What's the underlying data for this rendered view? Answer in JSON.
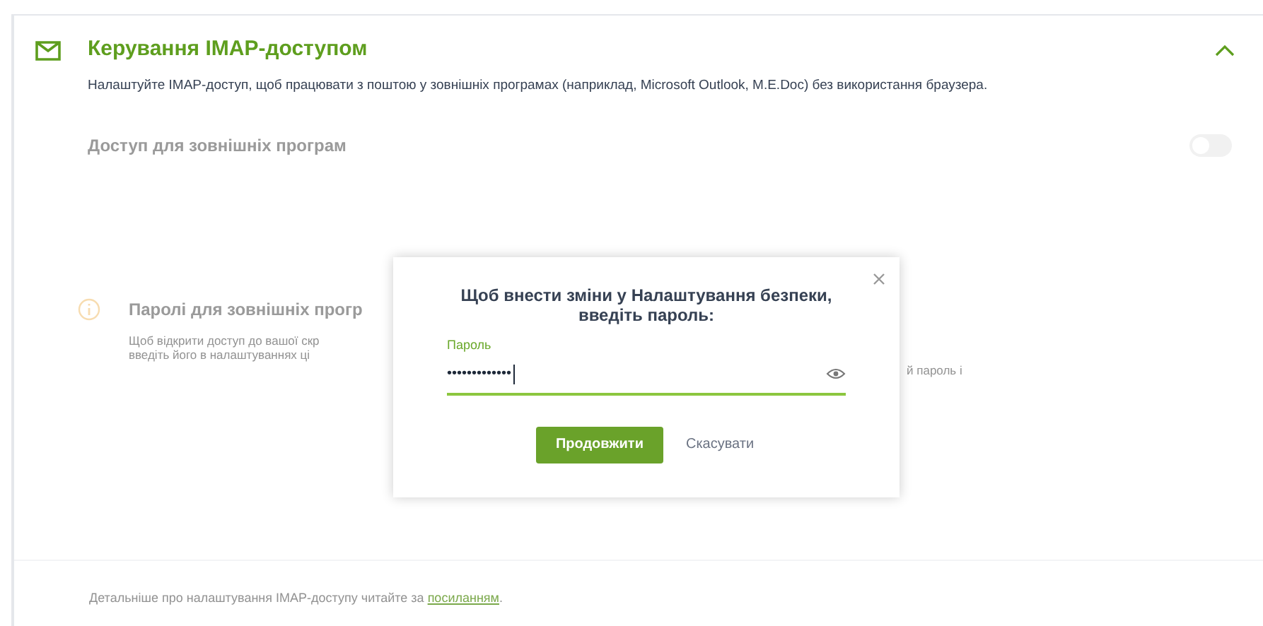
{
  "section": {
    "title": "Керування IMAP-доступом",
    "description": "Налаштуйте IMAP-доступ, щоб працювати з поштою у зовнішніх програмах (наприклад, Microsoft Outlook, M.E.Doc) без використання браузера.",
    "expanded": true
  },
  "access": {
    "label": "Доступ для зовнішніх програм",
    "on": false
  },
  "passwords": {
    "title": "Паролі для зовнішніх прогр",
    "text_left": [
      "Щоб відкрити доступ до вашої скр",
      "введіть його в налаштуваннях ці"
    ],
    "text_right": "й пароль і"
  },
  "footer": {
    "text": "Детальніше про налаштування IMAP-доступу читайте за ",
    "link": "посиланням",
    "end": "."
  },
  "dialog": {
    "title": "Щоб внести зміни у Налаштування безпеки, введіть пароль:",
    "field_label": "Пароль",
    "value": "•••••••••••••",
    "buttons": [
      {
        "label": "Продовжити",
        "kind": "primary"
      },
      {
        "label": "Скасувати",
        "kind": "link"
      }
    ]
  }
}
